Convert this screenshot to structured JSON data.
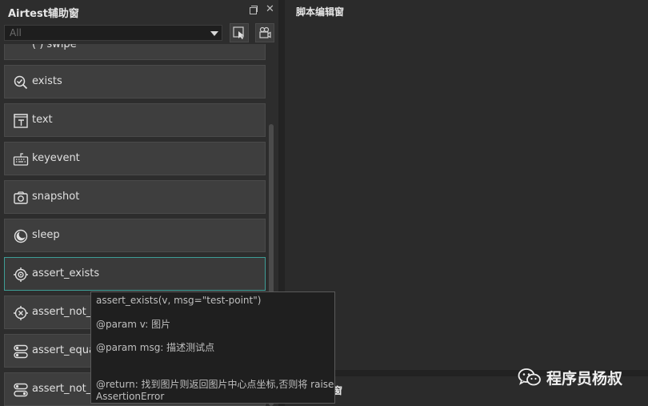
{
  "left_panel": {
    "title": "Airtest辅助窗",
    "filter_value": "All",
    "partial_item_label": "( ) swipe",
    "items": [
      {
        "label": "exists",
        "icon": "check-magnifier-icon"
      },
      {
        "label": "text",
        "icon": "text-box-icon"
      },
      {
        "label": "keyevent",
        "icon": "keyboard-icon"
      },
      {
        "label": "snapshot",
        "icon": "camera-icon"
      },
      {
        "label": "sleep",
        "icon": "moon-icon"
      },
      {
        "label": "assert_exists",
        "icon": "target-icon"
      },
      {
        "label": "assert_not_e",
        "icon": "circle-x-icon"
      },
      {
        "label": "assert_equal",
        "icon": "toggle-equal-icon"
      },
      {
        "label": "assert_not_e",
        "icon": "toggle-not-equal-icon"
      }
    ]
  },
  "editor": {
    "title": "脚本编辑窗",
    "bottom_title": "窗"
  },
  "tooltip": {
    "signature": "assert_exists(v, msg=\"test-point\")",
    "param_v": "@param v: 图片",
    "param_msg": "@param msg: 描述测试点",
    "return_line1": "@return: 找到图片则返回图片中心点坐标,否则将 raise",
    "return_line2": "AssertionError"
  },
  "watermark": {
    "text": "程序员杨叔"
  },
  "colors": {
    "selected_border": "#3e9d96",
    "panel_bg": "#2d2d2d",
    "item_bg": "#3e3e3e"
  }
}
